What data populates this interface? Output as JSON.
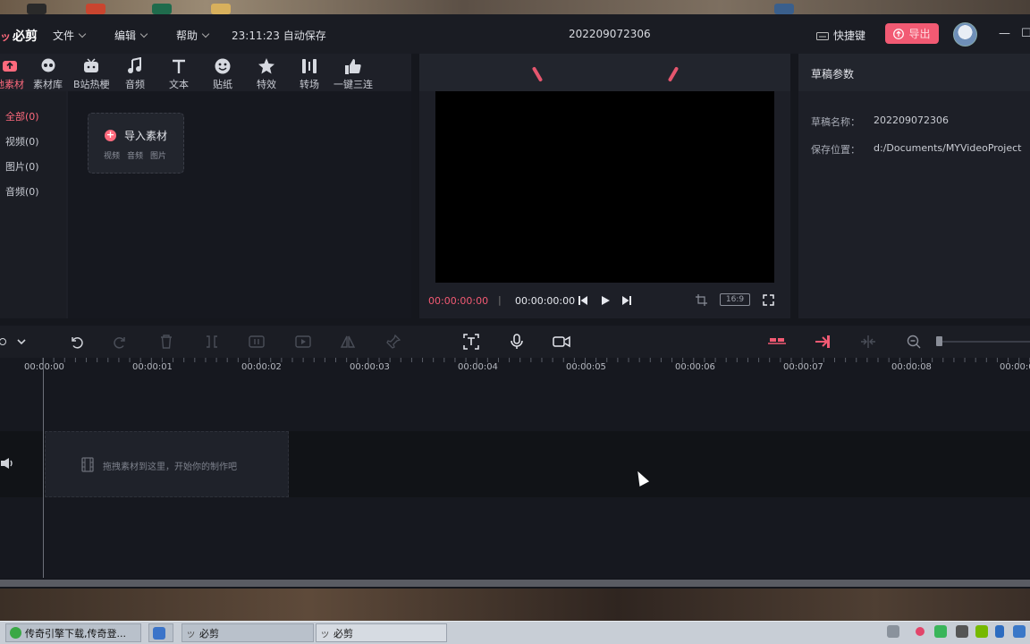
{
  "app": {
    "name": "必剪",
    "menu": [
      {
        "label": "文件"
      },
      {
        "label": "编辑"
      },
      {
        "label": "帮助"
      }
    ],
    "save_status": "23:11:23 自动保存",
    "project_title": "202209072306",
    "shortcut_label": "快捷键",
    "export_label": "导出"
  },
  "toolbar": {
    "items": [
      {
        "label": "地素材",
        "icon": "upload-icon",
        "active": true
      },
      {
        "label": "素材库",
        "icon": "skull-icon"
      },
      {
        "label": "B站热梗",
        "icon": "tv-icon"
      },
      {
        "label": "音频",
        "icon": "music-note-icon"
      },
      {
        "label": "文本",
        "icon": "text-t-icon"
      },
      {
        "label": "贴纸",
        "icon": "sticker-icon"
      },
      {
        "label": "特效",
        "icon": "sparkle-icon"
      },
      {
        "label": "转场",
        "icon": "transition-icon"
      },
      {
        "label": "一键三连",
        "icon": "thumbs-up-icon"
      }
    ]
  },
  "sidebar": {
    "categories": [
      {
        "label": "全部(0)",
        "active": true
      },
      {
        "label": "视频(0)"
      },
      {
        "label": "图片(0)"
      },
      {
        "label": "音频(0)"
      }
    ]
  },
  "import": {
    "label": "导入素材",
    "types": [
      "视频",
      "音频",
      "图片"
    ]
  },
  "preview": {
    "current_time": "00:00:00:00",
    "total_time": "00:00:00:00",
    "ratio": "16:9",
    "accent": "#f25a73"
  },
  "properties": {
    "title": "草稿参数",
    "rows": [
      {
        "label": "草稿名称：",
        "value": "202209072306"
      },
      {
        "label": "保存位置：",
        "value": "d:/Documents/MYVideoProject"
      }
    ]
  },
  "timeline": {
    "ticks": [
      "00:00:00",
      "00:00:01",
      "00:00:02",
      "00:00:03",
      "00:00:04",
      "00:00:05",
      "00:00:06",
      "00:00:07",
      "00:00:08",
      "00:00:0"
    ],
    "drop_hint": "拖拽素材到这里，开始你的制作吧"
  },
  "taskbar": {
    "tasks": [
      {
        "label": "传奇引擎下载,传奇登..."
      },
      {
        "label": "必剪"
      },
      {
        "label": "必剪",
        "active": true
      }
    ]
  }
}
